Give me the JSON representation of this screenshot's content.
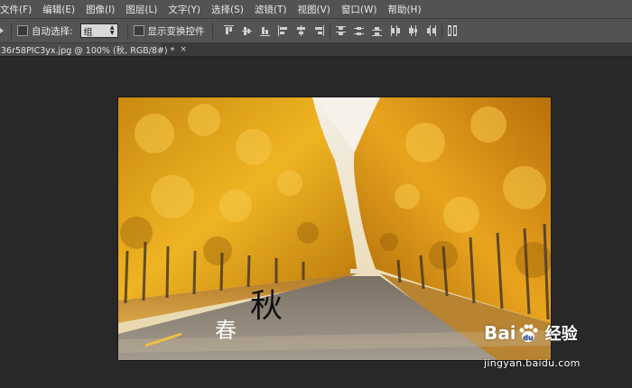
{
  "menu": [
    "文件(F)",
    "编辑(E)",
    "图像(I)",
    "图层(L)",
    "文字(Y)",
    "选择(S)",
    "滤镜(T)",
    "视图(V)",
    "窗口(W)",
    "帮助(H)"
  ],
  "options": {
    "auto_select_label": "自动选择:",
    "auto_select_value": "组",
    "show_transform_label": "显示变换控件"
  },
  "document_tab": {
    "title": "36r58PIC3yx.jpg @ 100% (秋, RGB/8#) *",
    "close": "×"
  },
  "canvas_text": {
    "chun": "春",
    "qiu": "秋"
  },
  "watermark": {
    "bai": "Bai",
    "du": "du",
    "jingyan": "经验",
    "url": "jingyan.baidu.com"
  },
  "colors": {
    "menu_bg": "#535353",
    "workspace_bg": "#282828",
    "foliage": "#e8a21c",
    "road": "#8e8478"
  }
}
